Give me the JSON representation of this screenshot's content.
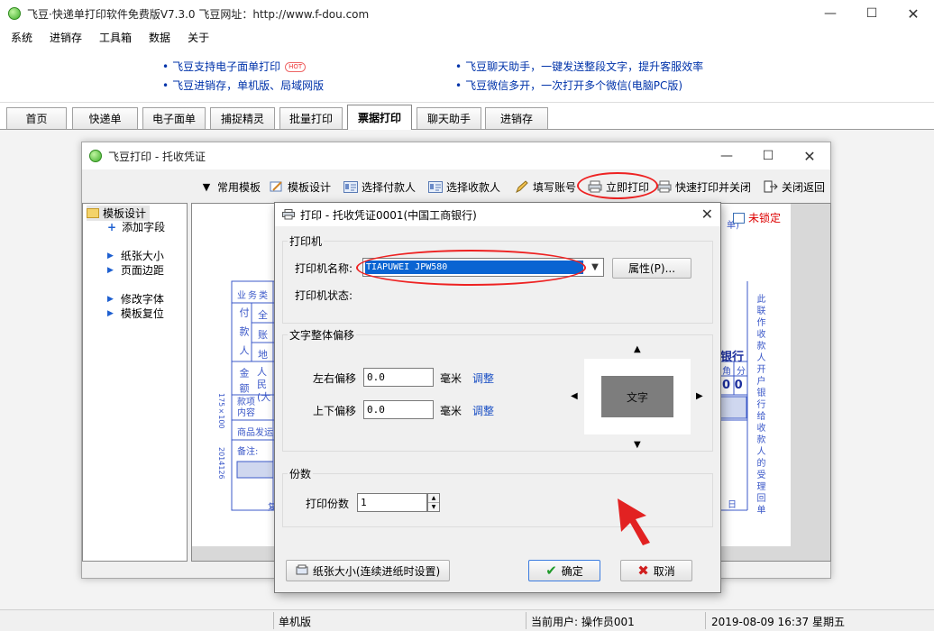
{
  "window": {
    "title": "飞豆·快递单打印软件免费版V7.3.0   飞豆网址：http://www.f-dou.com",
    "minimize": "—",
    "maximize": "☐",
    "close": "✕"
  },
  "menu": [
    "系统",
    "进销存",
    "工具箱",
    "数据",
    "关于"
  ],
  "banner": {
    "links": [
      "飞豆支持电子面单打印",
      "飞豆进销存，单机版、局域网版",
      "飞豆聊天助手，一键发送整段文字，提升客服效率",
      "飞豆微信多开，一次打开多个微信(电脑PC版)"
    ],
    "hot_badge": "HOT"
  },
  "tabs": [
    "首页",
    "快递单",
    "电子面单",
    "捕捉精灵",
    "批量打印",
    "票据打印",
    "聊天助手",
    "进销存"
  ],
  "child": {
    "title": "飞豆打印 - 托收凭证",
    "toolbar": [
      "常用模板",
      "模板设计",
      "选择付款人",
      "选择收款人",
      "填写账号",
      "立即打印",
      "快速打印并关闭",
      "关闭返回"
    ],
    "tree": {
      "root": "模板设计",
      "items": [
        "添加字段",
        "纸张大小",
        "页面边距",
        "修改字体",
        "模板复位"
      ]
    },
    "lock_label": "未锁定",
    "form": {
      "frag_tl": "付款人",
      "frag_right": "银行",
      "frag_jiao": "角",
      "frag_fen": "分",
      "frag_zeros": "0  0",
      "side_text": "此联作收款人开户银行给收款人的受理回单",
      "ri": "日",
      "col_a": "全",
      "col_b": "账",
      "col_c": "地",
      "jin_e": "金额",
      "ren_min": "人民(大",
      "kuan_xiang": "款项内容",
      "shang_pin": "商品发运",
      "bei_zhu": "备注:",
      "fu": "复",
      "sz": "175×100",
      "code": "2014126",
      "ye_wu": "业务类",
      "dan": "单)"
    }
  },
  "dialog": {
    "title": "打印 - 托收凭证0001(中国工商银行)",
    "printer_group": "打印机",
    "printer_name_label": "打印机名称:",
    "printer_name_value": "TIAPUWEI JPW580",
    "properties_button": "属性(P)...",
    "printer_status_label": "打印机状态:",
    "offset_group": "文字整体偏移",
    "h_offset_label": "左右偏移",
    "h_offset_value": "0.0",
    "v_offset_label": "上下偏移",
    "v_offset_value": "0.0",
    "unit": "毫米",
    "adjust_link": "调整",
    "preview_text": "文字",
    "copies_group": "份数",
    "copies_label": "打印份数",
    "copies_value": "1",
    "paper_button": "纸张大小(连续进纸时设置)",
    "ok_button": "确定",
    "cancel_button": "取消"
  },
  "status": {
    "edition": "单机版",
    "user": "当前用户: 操作员001",
    "datetime": "2019-08-09 16:37 星期五"
  },
  "colors": {
    "accent_blue": "#0a64d2",
    "annotation_red": "#e22222",
    "form_blue": "#3b58c8",
    "link_blue": "#0033aa"
  }
}
